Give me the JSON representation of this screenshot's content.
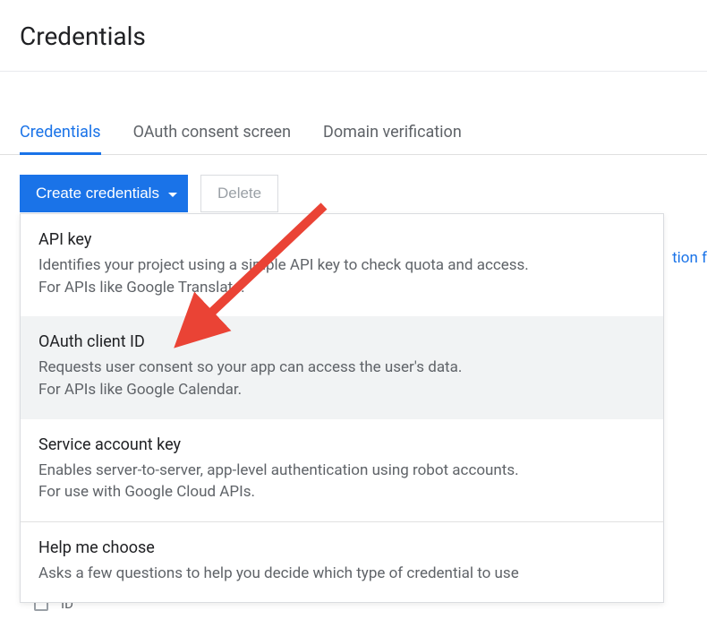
{
  "header": {
    "title": "Credentials"
  },
  "tabs": [
    {
      "label": "Credentials",
      "active": true
    },
    {
      "label": "OAuth consent screen",
      "active": false
    },
    {
      "label": "Domain verification",
      "active": false
    }
  ],
  "toolbar": {
    "create_label": "Create credentials",
    "delete_label": "Delete"
  },
  "dropdown": {
    "items": [
      {
        "title": "API key",
        "desc": "Identifies your project using a simple API key to check quota and access.\nFor APIs like Google Translate.",
        "highlight": false
      },
      {
        "title": "OAuth client ID",
        "desc": "Requests user consent so your app can access the user's data.\nFor APIs like Google Calendar.",
        "highlight": true
      },
      {
        "title": "Service account key",
        "desc": "Enables server-to-server, app-level authentication using robot accounts.\nFor use with Google Cloud APIs.",
        "highlight": false
      },
      {
        "title": "Help me choose",
        "desc": "Asks a few questions to help you decide which type of credential to use",
        "highlight": false
      }
    ]
  },
  "background": {
    "link_fragment": "tion f",
    "table_header_fragment": "ID"
  },
  "annotation": {
    "arrow_color": "#ea4335"
  }
}
